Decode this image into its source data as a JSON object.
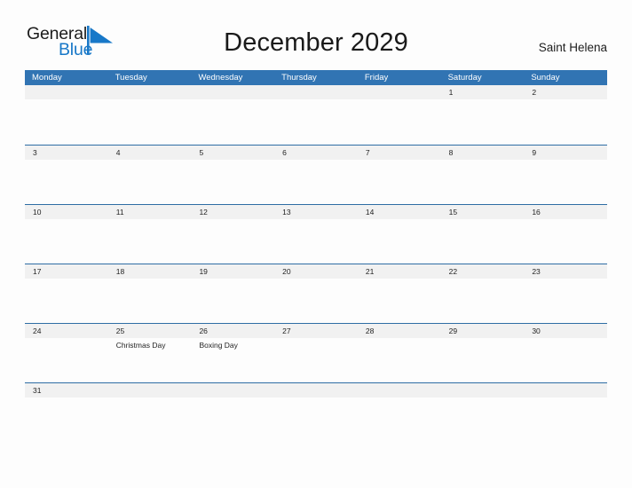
{
  "brand": {
    "word_one": "General",
    "word_two": "Blue",
    "sail_icon": "sail-triangle-icon",
    "color_dark": "#1d1d1d",
    "color_blue": "#1878c8"
  },
  "header": {
    "title": "December 2029",
    "location": "Saint Helena"
  },
  "theme": {
    "header_blue": "#3174b3",
    "row_rule_blue": "#2e6da4",
    "date_band_gray": "#f1f1f1",
    "page_background": "#fdfdfd"
  },
  "weekdays": [
    "Monday",
    "Tuesday",
    "Wednesday",
    "Thursday",
    "Friday",
    "Saturday",
    "Sunday"
  ],
  "weeks": [
    {
      "days": [
        {
          "num": "",
          "events": []
        },
        {
          "num": "",
          "events": []
        },
        {
          "num": "",
          "events": []
        },
        {
          "num": "",
          "events": []
        },
        {
          "num": "",
          "events": []
        },
        {
          "num": "1",
          "events": []
        },
        {
          "num": "2",
          "events": []
        }
      ]
    },
    {
      "days": [
        {
          "num": "3",
          "events": []
        },
        {
          "num": "4",
          "events": []
        },
        {
          "num": "5",
          "events": []
        },
        {
          "num": "6",
          "events": []
        },
        {
          "num": "7",
          "events": []
        },
        {
          "num": "8",
          "events": []
        },
        {
          "num": "9",
          "events": []
        }
      ]
    },
    {
      "days": [
        {
          "num": "10",
          "events": []
        },
        {
          "num": "11",
          "events": []
        },
        {
          "num": "12",
          "events": []
        },
        {
          "num": "13",
          "events": []
        },
        {
          "num": "14",
          "events": []
        },
        {
          "num": "15",
          "events": []
        },
        {
          "num": "16",
          "events": []
        }
      ]
    },
    {
      "days": [
        {
          "num": "17",
          "events": []
        },
        {
          "num": "18",
          "events": []
        },
        {
          "num": "19",
          "events": []
        },
        {
          "num": "20",
          "events": []
        },
        {
          "num": "21",
          "events": []
        },
        {
          "num": "22",
          "events": []
        },
        {
          "num": "23",
          "events": []
        }
      ]
    },
    {
      "days": [
        {
          "num": "24",
          "events": []
        },
        {
          "num": "25",
          "events": [
            "Christmas Day"
          ]
        },
        {
          "num": "26",
          "events": [
            "Boxing Day"
          ]
        },
        {
          "num": "27",
          "events": []
        },
        {
          "num": "28",
          "events": []
        },
        {
          "num": "29",
          "events": []
        },
        {
          "num": "30",
          "events": []
        }
      ]
    },
    {
      "days": [
        {
          "num": "31",
          "events": []
        },
        {
          "num": "",
          "events": []
        },
        {
          "num": "",
          "events": []
        },
        {
          "num": "",
          "events": []
        },
        {
          "num": "",
          "events": []
        },
        {
          "num": "",
          "events": []
        },
        {
          "num": "",
          "events": []
        }
      ]
    }
  ]
}
